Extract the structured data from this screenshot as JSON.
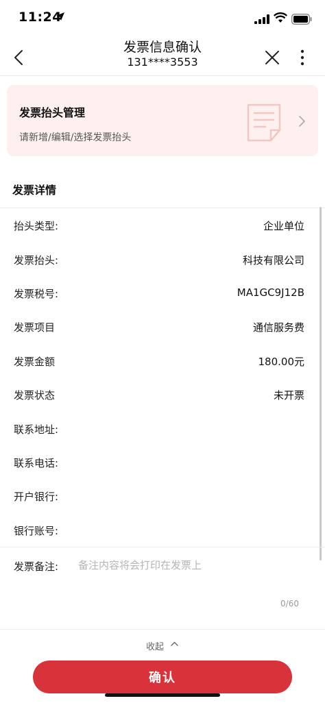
{
  "status_bar": {
    "time": "11:24"
  },
  "nav": {
    "title": "发票信息确认",
    "subtitle": "131****3553"
  },
  "header_management": {
    "title": "发票抬头管理",
    "description": "请新增/编辑/选择发票抬头"
  },
  "details": {
    "section_title": "发票详情",
    "rows": [
      {
        "label": "抬头类型:",
        "value": "企业单位"
      },
      {
        "label": "发票抬头:",
        "value": "科技有限公司"
      },
      {
        "label": "发票税号:",
        "value": "MA1GC9J12B"
      },
      {
        "label": "发票项目",
        "value": "通信服务费"
      },
      {
        "label": "发票金额",
        "value": "180.00元"
      },
      {
        "label": "发票状态",
        "value": "未开票"
      },
      {
        "label": "联系地址:",
        "value": ""
      },
      {
        "label": "联系电话:",
        "value": ""
      },
      {
        "label": "开户银行:",
        "value": ""
      },
      {
        "label": "银行账号:",
        "value": ""
      }
    ]
  },
  "remark": {
    "label": "发票备注:",
    "placeholder": "备注内容将会打印在发票上",
    "value": "",
    "counter": "0/60"
  },
  "collapse": {
    "label": "收起"
  },
  "confirm_button": {
    "label": "确认"
  },
  "colors": {
    "accent": "#d8323a",
    "card_bg": "#fdf0ee",
    "icon_tint": "#f3c7c1"
  }
}
